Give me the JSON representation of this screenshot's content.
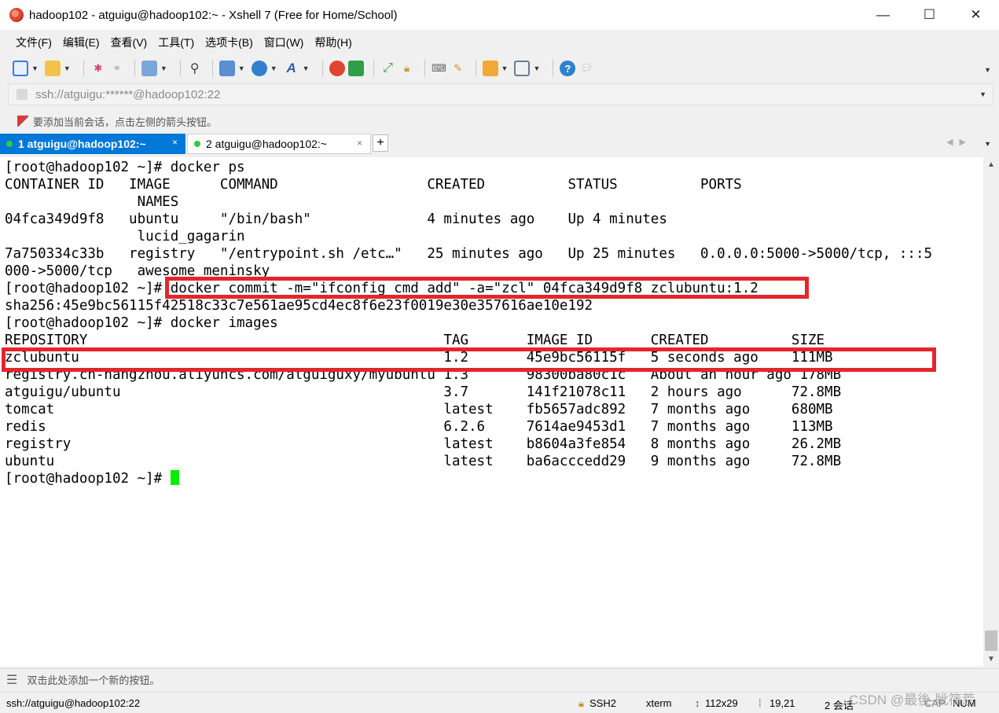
{
  "window": {
    "title": "hadoop102 - atguigu@hadoop102:~ - Xshell 7 (Free for Home/School)",
    "minimize_glyph": "—",
    "maximize_glyph": "☐",
    "close_glyph": "✕"
  },
  "menu": [
    "文件(F)",
    "编辑(E)",
    "查看(V)",
    "工具(T)",
    "选项卡(B)",
    "窗口(W)",
    "帮助(H)"
  ],
  "toolbar_icons": [
    "new-session-icon",
    "open-folder-icon",
    "disconnect-icon",
    "reconnect-icon",
    "properties-icon",
    "find-icon",
    "transfer-icon",
    "globe-icon",
    "font-icon",
    "xftp-icon",
    "xshell-green-icon",
    "fullscreen-icon",
    "lock-icon",
    "keyboard-icon",
    "compose-icon",
    "layout-icon",
    "tile-icon",
    "help-icon",
    "chat-icon"
  ],
  "address": {
    "text": "ssh://atguigu:******@hadoop102:22"
  },
  "hint": {
    "text": "要添加当前会话，点击左侧的箭头按钮。"
  },
  "tabs": [
    {
      "label": "1 atguigu@hadoop102:~",
      "active": true,
      "close": "×"
    },
    {
      "label": "2 atguigu@hadoop102:~",
      "active": false,
      "close": "×"
    }
  ],
  "tab_add": "+",
  "terminal": {
    "lines": [
      "[root@hadoop102 ~]# docker ps",
      "CONTAINER ID   IMAGE      COMMAND                  CREATED          STATUS          PORTS",
      "                NAMES",
      "04fca349d9f8   ubuntu     \"/bin/bash\"              4 minutes ago    Up 4 minutes",
      "                lucid_gagarin",
      "7a750334c33b   registry   \"/entrypoint.sh /etc…\"   25 minutes ago   Up 25 minutes   0.0.0.0:5000->5000/tcp, :::5",
      "000->5000/tcp   awesome_meninsky",
      "[root@hadoop102 ~]# docker commit -m=\"ifconfig cmd add\" -a=\"zcl\" 04fca349d9f8 zclubuntu:1.2",
      "sha256:45e9bc56115f42518c33c7e561ae95cd4ec8f6e23f0019e30e357616ae10e192",
      "[root@hadoop102 ~]# docker images",
      "REPOSITORY                                           TAG       IMAGE ID       CREATED          SIZE",
      "zclubuntu                                            1.2       45e9bc56115f   5 seconds ago    111MB",
      "registry.cn-hangzhou.aliyuncs.com/atguiguxy/myubuntu 1.3       98300ba80c1c   About an hour ago 178MB",
      "atguigu/ubuntu                                       3.7       141f21078c11   2 hours ago      72.8MB",
      "tomcat                                               latest    fb5657adc892   7 months ago     680MB",
      "redis                                                6.2.6     7614ae9453d1   7 months ago     113MB",
      "registry                                             latest    b8604a3fe854   8 months ago     26.2MB",
      "ubuntu                                               latest    ba6acccedd29   9 months ago     72.8MB"
    ],
    "prompt": "[root@hadoop102 ~]# "
  },
  "quickbar": {
    "text": "双击此处添加一个新的按钮。"
  },
  "status": {
    "connection": "ssh://atguigu@hadoop102:22",
    "protocol": "SSH2",
    "terminal_type": "xterm",
    "size": "112x29",
    "cursor_pos": "19,21",
    "sessions": "2 会话",
    "caps": "CAP",
    "num": "NUM"
  },
  "watermark": "CSDN @最後-眦篟莣",
  "colors": {
    "accent": "#0078d7",
    "highlight": "#e4262c",
    "cursor": "#00ee00"
  }
}
